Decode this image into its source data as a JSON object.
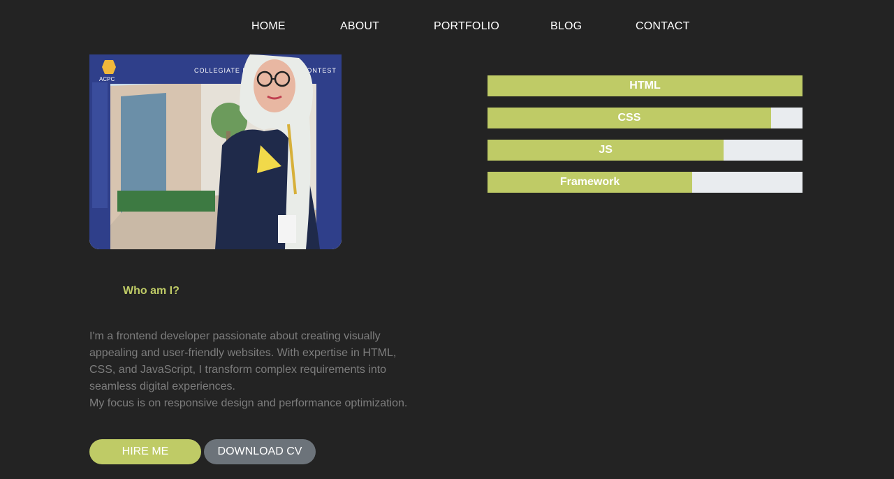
{
  "nav": {
    "items": [
      {
        "label": "HOME"
      },
      {
        "label": "ABOUT"
      },
      {
        "label": "PORTFOLIO"
      },
      {
        "label": "BLOG"
      },
      {
        "label": "CONTACT"
      }
    ]
  },
  "profile_photo": {
    "banner_text": "COLLEGIATE PROGRAMMING CONTEST",
    "banner_logo": "ACPC"
  },
  "about": {
    "heading": "Who am I?",
    "paragraph1": "I'm a frontend developer passionate about creating visually appealing and user-friendly websites. With expertise in HTML, CSS, and JavaScript, I transform complex requirements into seamless digital experiences.",
    "paragraph2": "My focus is on responsive design and performance optimization."
  },
  "buttons": {
    "hire_label": "HIRE ME",
    "cv_label": "DOWNLOAD CV"
  },
  "skills": [
    {
      "label": "HTML",
      "percent": 100
    },
    {
      "label": "CSS",
      "percent": 90
    },
    {
      "label": "JS",
      "percent": 75
    },
    {
      "label": "Framework",
      "percent": 65
    }
  ],
  "colors": {
    "background": "#232323",
    "accent": "#bfcb66",
    "secondary_button": "#6c737a",
    "track": "#e9ecef",
    "muted_text": "#7d7d7d"
  }
}
